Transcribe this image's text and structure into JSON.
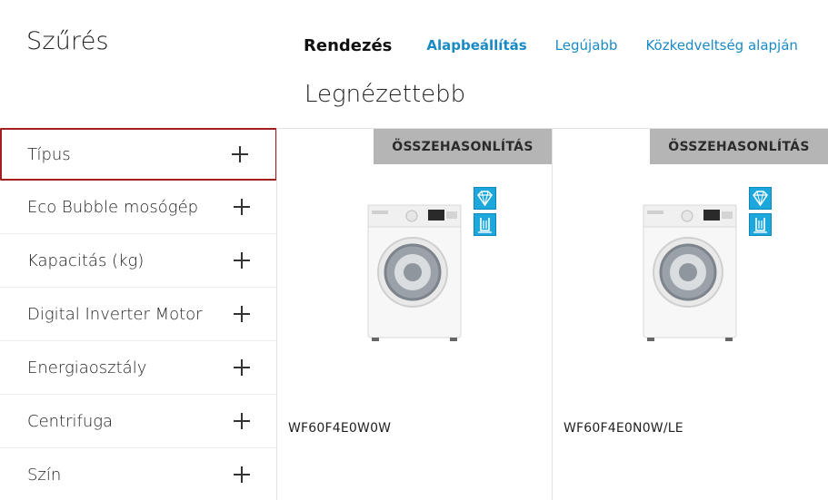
{
  "filter": {
    "title": "Szűrés"
  },
  "sort": {
    "label": "Rendezés",
    "options": [
      "Alapbeállítás",
      "Legújabb",
      "Közkedveltség alapján"
    ]
  },
  "page": {
    "title": "Legnézettebb"
  },
  "filters": [
    {
      "label": "Típus"
    },
    {
      "label": "Eco Bubble mosógép"
    },
    {
      "label": "Kapacitás (kg)"
    },
    {
      "label": "Digital Inverter Motor"
    },
    {
      "label": "Energiaosztály"
    },
    {
      "label": "Centrifuga"
    },
    {
      "label": "Szín"
    }
  ],
  "products": [
    {
      "name": "WF60F4E0W0W",
      "compare_label": "ÖSSZEHASONLÍTÁS",
      "icons": [
        "diamond-icon",
        "drum-icon"
      ]
    },
    {
      "name": "WF60F4E0N0W/LE",
      "compare_label": "ÖSSZEHASONLÍTÁS",
      "icons": [
        "diamond-icon",
        "drum-icon"
      ]
    }
  ],
  "colors": {
    "accent": "#1a8ac4",
    "selected_border": "#a31f1f",
    "compare_bg": "#b5b5b5",
    "feature_icon": "#1ca7dd"
  }
}
